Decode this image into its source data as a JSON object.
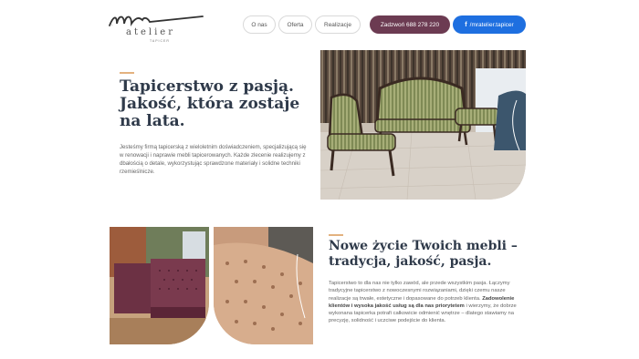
{
  "brand": {
    "script": "mr",
    "word": "atelier",
    "sub": "TAPICER"
  },
  "nav": {
    "items": [
      "O nas",
      "Oferta",
      "Realizacje"
    ],
    "call_label": "Zadzwoń 688 278 220",
    "fb_icon": "f",
    "fb_label": "/mratelier.tapicer"
  },
  "hero": {
    "title": "Tapicerstwo z pasją. Jakość, która zostaje na lata.",
    "text": "Jesteśmy firmą tapicerską z wieloletnim doświadczeniem, specjalizującą się w renowacji i naprawie mebli tapicerowanych. Każde zlecenie realizujemy z dbałością o detale, wykorzystując sprawdzone materiały i solidne techniki rzemieślnicze."
  },
  "section2": {
    "title": "Nowe życie Twoich mebli – tradycja, jakość, pasja.",
    "text_1": "Tapicerstwo to dla nas nie tylko zawód, ale przede wszystkim pasja. Łączymy tradycyjne tapicerstwo z nowoczesnymi rozwiązaniami, dzięki czemu nasze realizacje są trwałe, estetyczne i dopasowane do potrzeb klienta. ",
    "text_bold": "Zadowolenie klientów i wysoka jakość usług są dla nas priorytetem",
    "text_2": " i wierzymy, że dobrze wykonana tapicerka potrafi całkowicie odmienić wnętrze – dlatego stawiamy na precyzję, solidność i uczciwe podejście do klienta."
  },
  "colors": {
    "accent": "#e3b27f",
    "call_button": "#6c3b52",
    "fb_button": "#1e6fe0",
    "heading": "#2f3a4a"
  }
}
